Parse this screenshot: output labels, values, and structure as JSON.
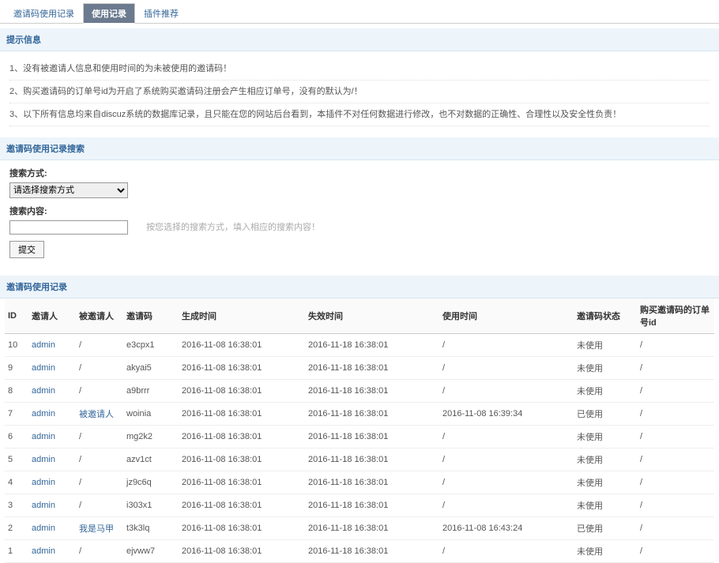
{
  "tabs": [
    {
      "label": "邀请码使用记录",
      "active": false
    },
    {
      "label": "使用记录",
      "active": true
    },
    {
      "label": "插件推荐",
      "active": false
    }
  ],
  "sections": {
    "tips_title": "提示信息",
    "search_title": "邀请码使用记录搜索",
    "records_title": "邀请码使用记录"
  },
  "tips": [
    "1、没有被邀请人信息和使用时间的为未被使用的邀请码！",
    "2、购买邀请码的订单号id为开启了系统购买邀请码注册会产生相应订单号，没有的默认为/！",
    "3、以下所有信息均来自discuz系统的数据库记录，且只能在您的网站后台看到，本插件不对任何数据进行修改，也不对数据的正确性、合理性以及安全性负责！"
  ],
  "search": {
    "method_label": "搜索方式:",
    "method_placeholder": "请选择搜索方式",
    "content_label": "搜索内容:",
    "content_value": "",
    "hint": "按您选择的搜索方式，填入相应的搜索内容！",
    "submit": "提交"
  },
  "columns": [
    "ID",
    "邀请人",
    "被邀请人",
    "邀请码",
    "生成时间",
    "失效时间",
    "使用时间",
    "邀请码状态",
    "购买邀请码的订单号id"
  ],
  "rows": [
    {
      "id": "10",
      "inviter": "admin",
      "invitee": "/",
      "code": "e3cpx1",
      "gen": "2016-11-08 16:38:01",
      "exp": "2016-11-18 16:38:01",
      "use": "/",
      "status": "未使用",
      "order": "/"
    },
    {
      "id": "9",
      "inviter": "admin",
      "invitee": "/",
      "code": "akyai5",
      "gen": "2016-11-08 16:38:01",
      "exp": "2016-11-18 16:38:01",
      "use": "/",
      "status": "未使用",
      "order": "/"
    },
    {
      "id": "8",
      "inviter": "admin",
      "invitee": "/",
      "code": "a9brrr",
      "gen": "2016-11-08 16:38:01",
      "exp": "2016-11-18 16:38:01",
      "use": "/",
      "status": "未使用",
      "order": "/"
    },
    {
      "id": "7",
      "inviter": "admin",
      "invitee": "被邀请人",
      "code": "woinia",
      "gen": "2016-11-08 16:38:01",
      "exp": "2016-11-18 16:38:01",
      "use": "2016-11-08 16:39:34",
      "status": "已使用",
      "order": "/"
    },
    {
      "id": "6",
      "inviter": "admin",
      "invitee": "/",
      "code": "mg2k2",
      "gen": "2016-11-08 16:38:01",
      "exp": "2016-11-18 16:38:01",
      "use": "/",
      "status": "未使用",
      "order": "/"
    },
    {
      "id": "5",
      "inviter": "admin",
      "invitee": "/",
      "code": "azv1ct",
      "gen": "2016-11-08 16:38:01",
      "exp": "2016-11-18 16:38:01",
      "use": "/",
      "status": "未使用",
      "order": "/"
    },
    {
      "id": "4",
      "inviter": "admin",
      "invitee": "/",
      "code": "jz9c6q",
      "gen": "2016-11-08 16:38:01",
      "exp": "2016-11-18 16:38:01",
      "use": "/",
      "status": "未使用",
      "order": "/"
    },
    {
      "id": "3",
      "inviter": "admin",
      "invitee": "/",
      "code": "i303x1",
      "gen": "2016-11-08 16:38:01",
      "exp": "2016-11-18 16:38:01",
      "use": "/",
      "status": "未使用",
      "order": "/"
    },
    {
      "id": "2",
      "inviter": "admin",
      "invitee": "我是马甲",
      "code": "t3k3lq",
      "gen": "2016-11-08 16:38:01",
      "exp": "2016-11-18 16:38:01",
      "use": "2016-11-08 16:43:24",
      "status": "已使用",
      "order": "/"
    },
    {
      "id": "1",
      "inviter": "admin",
      "invitee": "/",
      "code": "ejvww7",
      "gen": "2016-11-08 16:38:01",
      "exp": "2016-11-18 16:38:01",
      "use": "/",
      "status": "未使用",
      "order": "/"
    }
  ]
}
